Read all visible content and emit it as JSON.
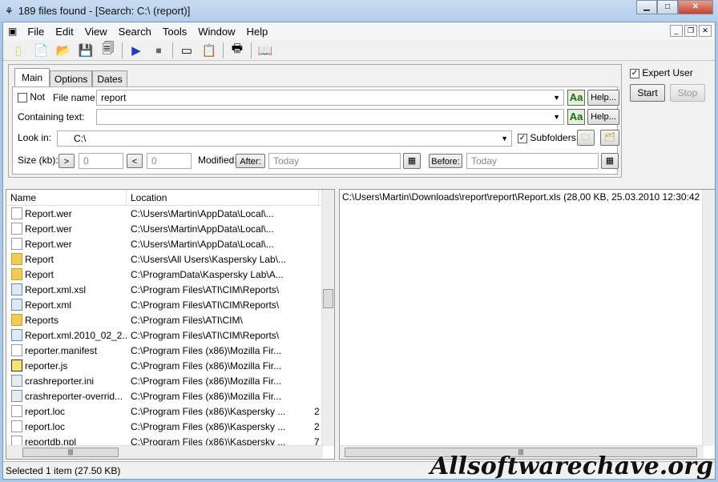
{
  "window": {
    "title": "189 files found - [Search: C:\\ (report)]"
  },
  "menu": [
    "File",
    "Edit",
    "View",
    "Search",
    "Tools",
    "Window",
    "Help"
  ],
  "toolbar": [
    "new-icon",
    "new-from-template-icon",
    "open-icon",
    "save-icon",
    "save-as-icon",
    "start-icon",
    "stop-icon",
    "window-icon",
    "properties-icon",
    "print-icon",
    "help-book-icon"
  ],
  "tabs": [
    "Main",
    "Options",
    "Dates"
  ],
  "form": {
    "not_label": "Not",
    "file_name_label": "File name:",
    "file_name_value": "report",
    "containing_label": "Containing text:",
    "containing_value": "",
    "help_label": "Help...",
    "aa_label": "Aa",
    "look_in_label": "Look in:",
    "look_in_value": "C:\\",
    "subfolders_label": "Subfolders",
    "size_label": "Size (kb):",
    "gt": ">",
    "lt": "<",
    "size_min": "0",
    "size_max": "0",
    "modified_label": "Modified:",
    "after_label": "After:",
    "after_placeholder": "Today",
    "before_label": "Before:",
    "before_placeholder": "Today"
  },
  "right": {
    "expert_label": "Expert User",
    "start": "Start",
    "stop": "Stop"
  },
  "list": {
    "columns": [
      "Name",
      "Location"
    ],
    "rows": [
      {
        "name": "Report.wer",
        "loc": "C:\\Users\\Martin\\AppData\\Local\\...",
        "extra": "",
        "icon": "file"
      },
      {
        "name": "Report.wer",
        "loc": "C:\\Users\\Martin\\AppData\\Local\\...",
        "extra": "",
        "icon": "file"
      },
      {
        "name": "Report.wer",
        "loc": "C:\\Users\\Martin\\AppData\\Local\\...",
        "extra": "",
        "icon": "file"
      },
      {
        "name": "Report",
        "loc": "C:\\Users\\All Users\\Kaspersky Lab\\...",
        "extra": "",
        "icon": "folder"
      },
      {
        "name": "Report",
        "loc": "C:\\ProgramData\\Kaspersky Lab\\A...",
        "extra": "",
        "icon": "folder"
      },
      {
        "name": "Report.xml.xsl",
        "loc": "C:\\Program Files\\ATI\\CIM\\Reports\\",
        "extra": "",
        "icon": "xml"
      },
      {
        "name": "Report.xml",
        "loc": "C:\\Program Files\\ATI\\CIM\\Reports\\",
        "extra": "",
        "icon": "xml"
      },
      {
        "name": "Reports",
        "loc": "C:\\Program Files\\ATI\\CIM\\",
        "extra": "",
        "icon": "folder"
      },
      {
        "name": "Report.xml.2010_02_2...",
        "loc": "C:\\Program Files\\ATI\\CIM\\Reports\\",
        "extra": "",
        "icon": "xml"
      },
      {
        "name": "reporter.manifest",
        "loc": "C:\\Program Files (x86)\\Mozilla Fir...",
        "extra": "",
        "icon": "file"
      },
      {
        "name": "reporter.js",
        "loc": "C:\\Program Files (x86)\\Mozilla Fir...",
        "extra": "",
        "icon": "js"
      },
      {
        "name": "crashreporter.ini",
        "loc": "C:\\Program Files (x86)\\Mozilla Fir...",
        "extra": "",
        "icon": "ini"
      },
      {
        "name": "crashreporter-overrid...",
        "loc": "C:\\Program Files (x86)\\Mozilla Fir...",
        "extra": "",
        "icon": "ini"
      },
      {
        "name": "report.loc",
        "loc": "C:\\Program Files (x86)\\Kaspersky ...",
        "extra": "2",
        "icon": "file"
      },
      {
        "name": "report.loc",
        "loc": "C:\\Program Files (x86)\\Kaspersky ...",
        "extra": "2",
        "icon": "file"
      },
      {
        "name": "reportdb.npl",
        "loc": "C:\\Program Files (x86)\\Kaspersky ...",
        "extra": "7",
        "icon": "file"
      }
    ]
  },
  "preview": {
    "text": "C:\\Users\\Martin\\Downloads\\report\\report\\Report.xls   (28,00 KB,  25.03.2010 12:30:42"
  },
  "status": {
    "text": "Selected 1 item (27.50 KB)"
  },
  "watermark": "Allsoftwarechave.org"
}
